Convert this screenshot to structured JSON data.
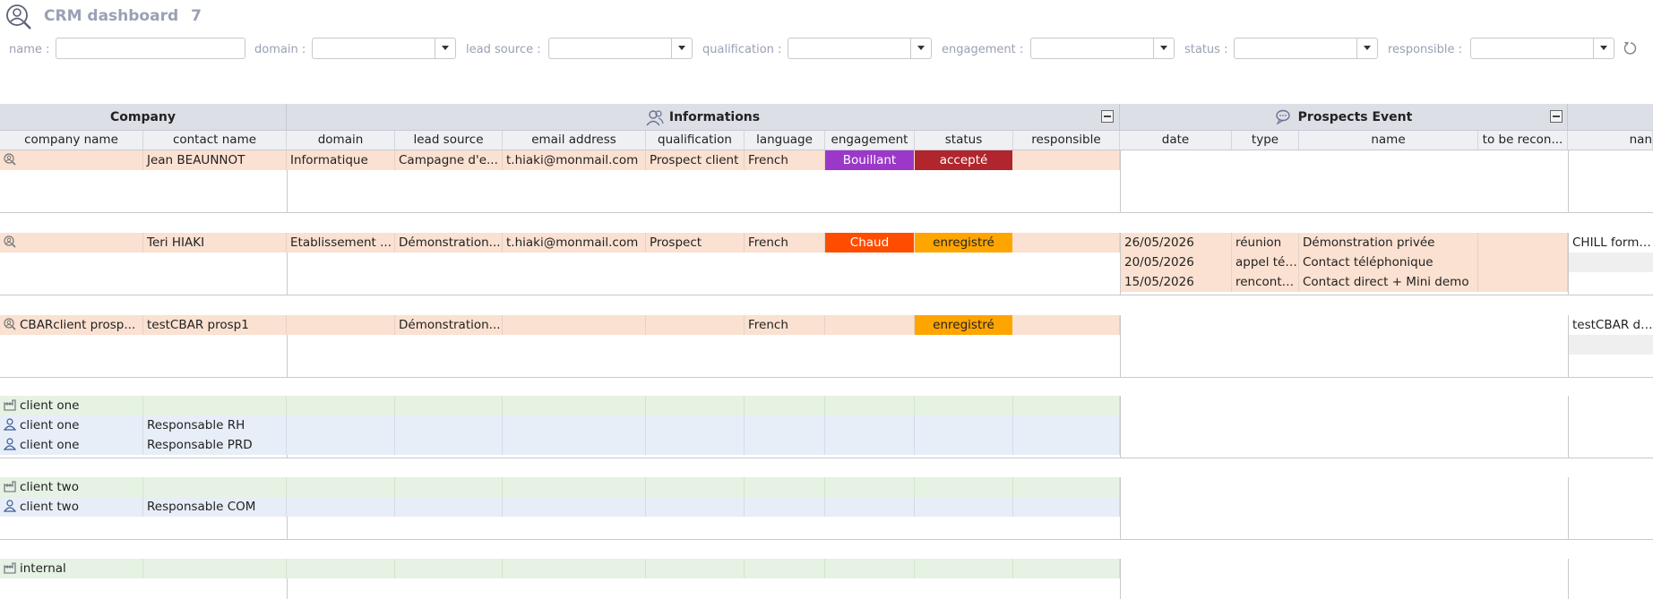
{
  "app": {
    "title": "CRM dashboard",
    "count": "7"
  },
  "filters": {
    "name_label": "name :",
    "domain_label": "domain :",
    "lead_source_label": "lead source :",
    "qualification_label": "qualification :",
    "engagement_label": "engagement :",
    "status_label": "status :",
    "responsible_label": "responsible :"
  },
  "groups": {
    "company": "Company",
    "informations": "Informations",
    "prospects_event": "Prospects Event"
  },
  "columns": {
    "company_name": "company name",
    "contact_name": "contact name",
    "domain": "domain",
    "lead_source": "lead source",
    "email_address": "email address",
    "qualification": "qualification",
    "language": "language",
    "engagement": "engagement",
    "status": "status",
    "responsible": "responsible",
    "date": "date",
    "type": "type",
    "name": "name",
    "to_be_reconsidered": "to be recon...",
    "name2": "nan"
  },
  "rows": {
    "r1": {
      "company": "",
      "contact": "Jean BEAUNNOT",
      "domain": "Informatique",
      "lead_source": "Campagne d'e...",
      "email": "t.hiaki@monmail.com",
      "qualification": "Prospect client",
      "language": "French",
      "engagement": "Bouillant",
      "status": "accepté"
    },
    "r2": {
      "company": "",
      "contact": "Teri HIAKI",
      "domain": "Etablissement ...",
      "lead_source": "Démonstration...",
      "email": "t.hiaki@monmail.com",
      "qualification": "Prospect",
      "language": "French",
      "engagement": "Chaud",
      "status": "enregistré",
      "events": [
        {
          "date": "26/05/2026",
          "type": "réunion",
          "name": "Démonstration privée"
        },
        {
          "date": "20/05/2026",
          "type": "appel téléph...",
          "name": "Contact téléphonique"
        },
        {
          "date": "15/05/2026",
          "type": "rencontre en...",
          "name": "Contact direct + Mini demo"
        }
      ],
      "right": "CHILL formati"
    },
    "r3": {
      "company": "CBARclient prosp...",
      "contact": "testCBAR prosp1",
      "lead_source": "Démonstration...",
      "language": "French",
      "status": "enregistré",
      "right": "testCBAR dev"
    },
    "b4": [
      {
        "company": "client one",
        "contact": ""
      },
      {
        "company": "client one",
        "contact": "Responsable RH"
      },
      {
        "company": "client one",
        "contact": "Responsable PRD"
      }
    ],
    "b5": [
      {
        "company": "client two",
        "contact": ""
      },
      {
        "company": "client two",
        "contact": "Responsable COM"
      }
    ],
    "b6": [
      {
        "company": "internal",
        "contact": ""
      }
    ]
  },
  "colors": {
    "bouillant": "#9b38c9",
    "chaud": "#ff4d00",
    "accepte": "#b0262c",
    "enregistre": "#ffa500",
    "header": "#dcdfe6"
  }
}
